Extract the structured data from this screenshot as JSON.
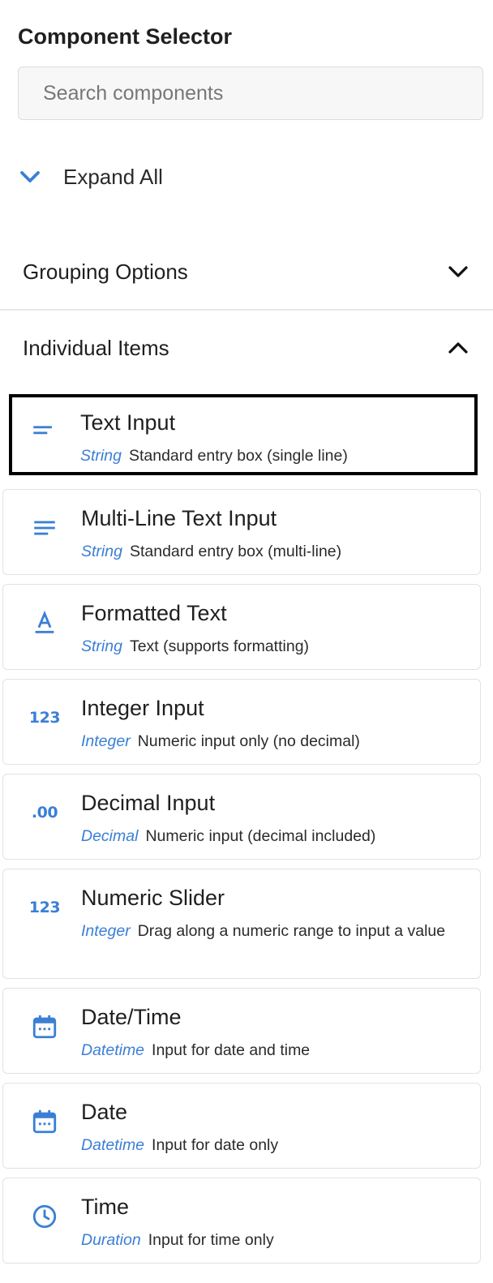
{
  "header": {
    "title": "Component Selector"
  },
  "search": {
    "placeholder": "Search components"
  },
  "expand": {
    "label": "Expand All"
  },
  "groups": [
    {
      "label": "Grouping Options",
      "state": "collapsed"
    },
    {
      "label": "Individual Items",
      "state": "expanded"
    }
  ],
  "colors": {
    "accent": "#3a7fd5",
    "selected_border": "#000000"
  },
  "items": [
    {
      "name": "Text Input",
      "type": "String",
      "desc": "Standard entry box (single line)",
      "icon": "short-text-icon",
      "selected": true
    },
    {
      "name": "Multi-Line Text Input",
      "type": "String",
      "desc": "Standard entry box (multi-line)",
      "icon": "multiline-text-icon"
    },
    {
      "name": "Formatted Text",
      "type": "String",
      "desc": "Text (supports formatting)",
      "icon": "format-text-icon"
    },
    {
      "name": "Integer Input",
      "type": "Integer",
      "desc": "Numeric input only (no decimal)",
      "icon": "numbers-icon",
      "icon_text": "123"
    },
    {
      "name": "Decimal Input",
      "type": "Decimal",
      "desc": "Numeric input (decimal included)",
      "icon": "decimal-icon",
      "icon_text": ".00"
    },
    {
      "name": "Numeric Slider",
      "type": "Integer",
      "desc": "Drag along a numeric range to input a value",
      "icon": "numbers-icon",
      "icon_text": "123"
    },
    {
      "name": "Date/Time",
      "type": "Datetime",
      "desc": "Input for date and time",
      "icon": "calendar-icon"
    },
    {
      "name": "Date",
      "type": "Datetime",
      "desc": "Input for date only",
      "icon": "calendar-icon"
    },
    {
      "name": "Time",
      "type": "Duration",
      "desc": "Input for time only",
      "icon": "clock-icon"
    }
  ]
}
